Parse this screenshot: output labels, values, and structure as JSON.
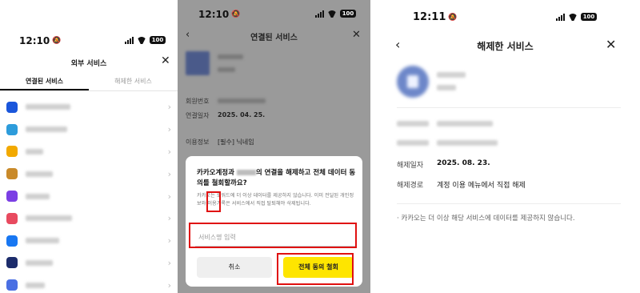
{
  "panel1": {
    "time": "12:10",
    "battery": "100",
    "title": "외부 서비스",
    "tabs": [
      {
        "label": "연결된 서비스",
        "active": true
      },
      {
        "label": "해제한 서비스",
        "active": false
      }
    ],
    "services": [
      {
        "icon": "wave-app-icon",
        "color": "#1a56db"
      },
      {
        "icon": "p-app-icon",
        "color": "#2d9cdb"
      },
      {
        "icon": "game-app-icon",
        "color": "#f2a900"
      },
      {
        "icon": "mushroom-app-icon",
        "color": "#c98a2a"
      },
      {
        "icon": "purple-app-icon",
        "color": "#7b3fe4"
      },
      {
        "icon": "poem-logo-icon",
        "color": "#e84a5f"
      },
      {
        "icon": "cloud-app-icon",
        "color": "#1877f2"
      },
      {
        "icon": "c-app-icon",
        "color": "#1c2c6b"
      },
      {
        "icon": "blue-app-icon",
        "color": "#4a6fe3"
      }
    ]
  },
  "panel2": {
    "time": "12:10",
    "battery": "100",
    "title": "연결된 서비스",
    "member_label": "회원번호",
    "date_label": "연결일자",
    "date_value": "2025. 04. 25.",
    "info_label": "이용정보",
    "info_value": "[필수] 닉네임",
    "dialog": {
      "title_a": "카카오계정과",
      "title_b": "의 연결을 해제하고 전체 데이터 동의를 철회할까요?",
      "desc": "카카오는 로워드에 더 이상 데이터를 제공하지 않습니다. 이미 전달된 개인정보와 이용기록은 서비스에서 직접 탈퇴해야 삭제됩니다.",
      "input_placeholder": "서비스명 입력",
      "cancel": "취소",
      "confirm": "전체 동의 철회"
    }
  },
  "panel3": {
    "time": "12:11",
    "battery": "100",
    "title": "해제한 서비스",
    "date_label": "해제일자",
    "date_value": "2025. 08. 23.",
    "route_label": "해제경로",
    "route_value": "계정 이용 메뉴에서 직접 해제",
    "note": "·  카카오는 더 이상 해당 서비스에 데이터를 제공하지 않습니다."
  }
}
